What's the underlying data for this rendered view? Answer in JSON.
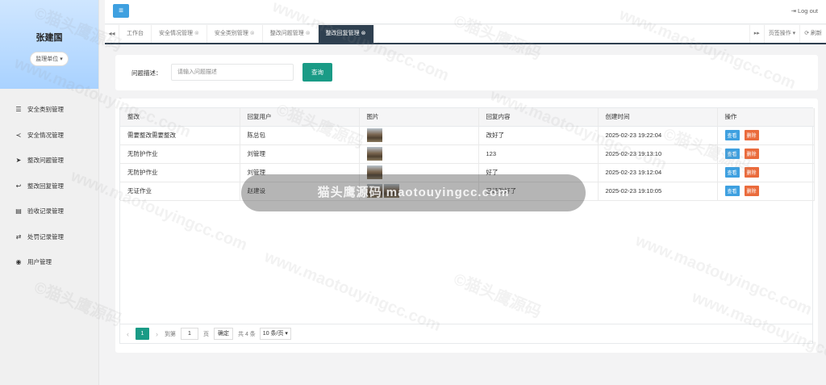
{
  "sidebar": {
    "user_name": "张建国",
    "user_role": "监理单位 ▾",
    "items": [
      {
        "label": "安全类别管理",
        "icon": "sliders-icon",
        "glyph": "☰"
      },
      {
        "label": "安全情况管理",
        "icon": "share-icon",
        "glyph": "≺"
      },
      {
        "label": "整改问题管理",
        "icon": "send-icon",
        "glyph": "➤"
      },
      {
        "label": "整改回复管理",
        "icon": "reply-icon",
        "glyph": "↩"
      },
      {
        "label": "验收记录管理",
        "icon": "list-icon",
        "glyph": "▤"
      },
      {
        "label": "处罚记录管理",
        "icon": "random-icon",
        "glyph": "⇄"
      },
      {
        "label": "用户管理",
        "icon": "user-circle-icon",
        "glyph": "◉"
      }
    ]
  },
  "topbar": {
    "menu_glyph": "≡",
    "logout_label": "Log out",
    "logout_glyph": "⇥"
  },
  "tabs": {
    "left_glyph": "◂◂",
    "items": [
      {
        "label": "工作台",
        "closable": false
      },
      {
        "label": "安全情况管理",
        "closable": true
      },
      {
        "label": "安全类别管理",
        "closable": true
      },
      {
        "label": "整改问题管理",
        "closable": true
      },
      {
        "label": "整改回复管理",
        "closable": true,
        "active": true
      }
    ],
    "close_glyph": "⊗",
    "right_nav_glyph": "▸▸",
    "tab_ops_label": "页签操作 ▾",
    "refresh_label": "⟳ 刷新"
  },
  "search": {
    "label": "问题描述：",
    "placeholder": "请输入问题描述",
    "button_label": "查询"
  },
  "table": {
    "columns": [
      "整改",
      "回复用户",
      "图片",
      "回复内容",
      "创建时间",
      "操作"
    ],
    "rows": [
      {
        "issue": "需要整改需要整改",
        "user": "陈总包",
        "images": 1,
        "content": "改好了",
        "time": "2025-02-23 19:22:04"
      },
      {
        "issue": "无防护作业",
        "user": "刘管理",
        "images": 1,
        "content": "123",
        "time": "2025-02-23 19:13:10"
      },
      {
        "issue": "无防护作业",
        "user": "刘管理",
        "images": 1,
        "content": "好了",
        "time": "2025-02-23 19:12:04"
      },
      {
        "issue": "无证作业",
        "user": "赵建设",
        "images": 2,
        "content": "已经改好了",
        "time": "2025-02-23 19:10:05"
      }
    ],
    "view_label": "查看",
    "delete_label": "删除"
  },
  "pagination": {
    "prev_glyph": "‹",
    "next_glyph": "›",
    "current_page": "1",
    "goto_label": "到第",
    "page_input": "1",
    "page_unit": "页",
    "confirm_label": "确定",
    "total_label": "共 4 条",
    "page_size_label": "10 条/页 ▾"
  },
  "overlay": {
    "text": "猫头鹰源码 maotouyingcc.com"
  },
  "watermark": {
    "text_cn": "©猫头鹰源码",
    "text_en": "www.maotouyingcc.com"
  },
  "colors": {
    "accent_teal": "#1a9b86",
    "tab_active": "#2f4050",
    "view_blue": "#3ea0e0",
    "delete_orange": "#ea6b3c"
  }
}
